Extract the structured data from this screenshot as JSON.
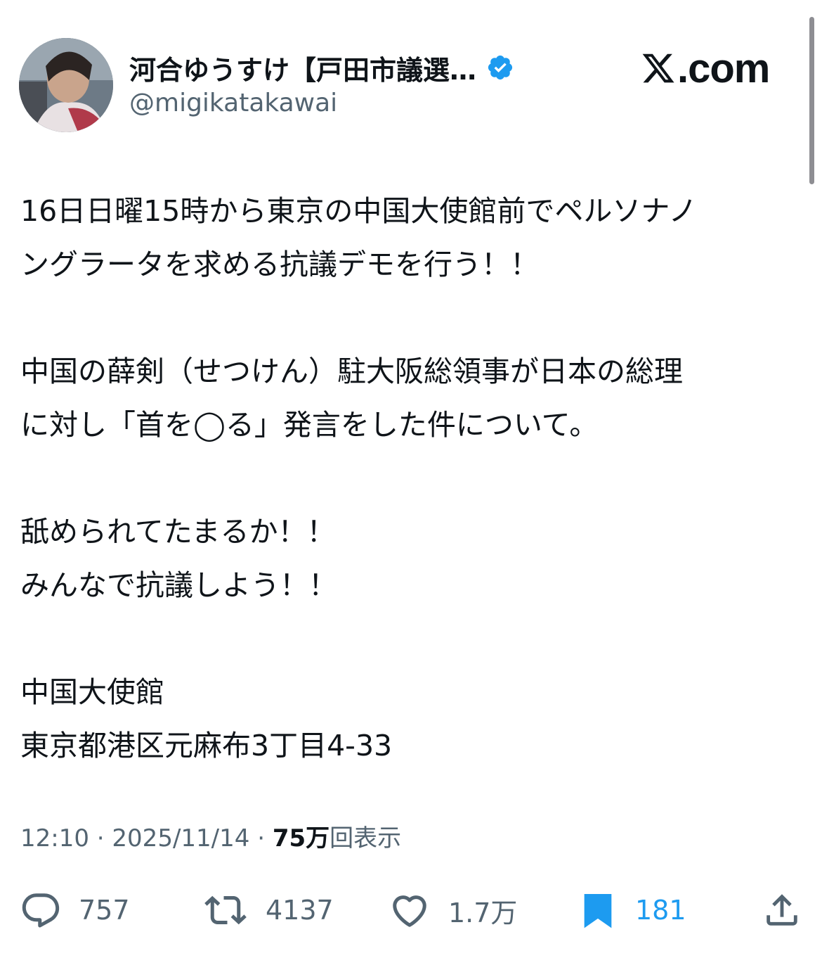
{
  "author": {
    "display_name": "河合ゆうすけ【戸田市議選…",
    "handle": "@migikatakawai",
    "verified_icon": "verified-badge-icon",
    "avatar_icon": "avatar-photo"
  },
  "site": {
    "logo_icon": "x-logo-icon",
    "name": ".com"
  },
  "tweet": {
    "lines": [
      "16日日曜15時から東京の中国大使館前でペルソナノ",
      "ングラータを求める抗議デモを行う！！",
      "",
      "中国の薛剣（せつけん）駐大阪総領事が日本の総理",
      "に対し「首を◯る」発言をした件について。",
      "",
      "舐められてたまるか！！",
      "みんなで抗議しよう！！",
      "",
      "中国大使館",
      "東京都港区元麻布3丁目4-33"
    ]
  },
  "meta": {
    "time": "12:10",
    "separator": "·",
    "date": "2025/11/14",
    "views_count": "75万",
    "views_label": "回表示"
  },
  "actions": {
    "reply": {
      "icon": "reply-icon",
      "count": "757"
    },
    "repost": {
      "icon": "repost-icon",
      "count": "4137"
    },
    "like": {
      "icon": "heart-icon",
      "count": "1.7万"
    },
    "bookmark": {
      "icon": "bookmark-icon",
      "count": "181",
      "active": true
    },
    "share": {
      "icon": "share-icon"
    }
  },
  "colors": {
    "text_primary": "#0f1419",
    "text_secondary": "#536471",
    "accent": "#1d9bf0"
  }
}
